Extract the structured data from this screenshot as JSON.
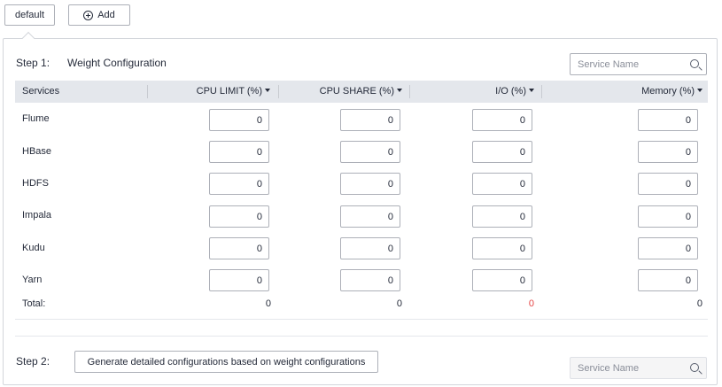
{
  "tabs": [
    {
      "label": "default"
    },
    {
      "label": "Add"
    }
  ],
  "step1": {
    "label": "Step 1:",
    "title": "Weight Configuration",
    "search_placeholder": "Service Name"
  },
  "table": {
    "columns": [
      "Services",
      "CPU LIMIT (%)",
      "CPU SHARE (%)",
      "I/O (%)",
      "Memory (%)"
    ],
    "rows": [
      {
        "service": "Flume",
        "values": [
          "0",
          "0",
          "0",
          "0"
        ]
      },
      {
        "service": "HBase",
        "values": [
          "0",
          "0",
          "0",
          "0"
        ]
      },
      {
        "service": "HDFS",
        "values": [
          "0",
          "0",
          "0",
          "0"
        ]
      },
      {
        "service": "Impala",
        "values": [
          "0",
          "0",
          "0",
          "0"
        ]
      },
      {
        "service": "Kudu",
        "values": [
          "0",
          "0",
          "0",
          "0"
        ]
      },
      {
        "service": "Yarn",
        "values": [
          "0",
          "0",
          "0",
          "0"
        ]
      }
    ],
    "total": {
      "label": "Total:",
      "values": [
        "0",
        "0",
        "0",
        "0"
      ]
    }
  },
  "colors": {
    "total_warning": "#e54545"
  },
  "step2": {
    "label": "Step 2:",
    "button_label": "Generate detailed configurations based on weight configurations",
    "search_placeholder": "Service Name"
  }
}
